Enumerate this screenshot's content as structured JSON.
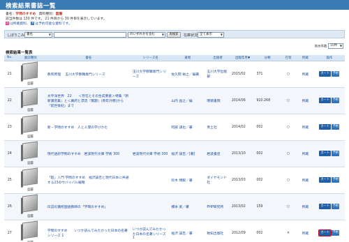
{
  "page_title": "検索結果書誌一覧",
  "criteria": {
    "label1": "書名：",
    "value1": "学問のすすめ",
    "label2": "資料種別：",
    "value2": "図書",
    "summary": "該当件数は 130 件です。 21 件目から 30 件目を表示しています。",
    "check1_icon": "カ",
    "check1_text": "は所蔵資料、",
    "check2_icon": "予",
    "check2_text": "は予約可能な資料です。"
  },
  "refine": {
    "label": "しぼりこみ",
    "field_select": "書名",
    "match_select": "のいずれかを含む",
    "search_button": "再検索",
    "status_label": "在庫状況",
    "status_select": "全て表示"
  },
  "display_count": {
    "label": "表示件数",
    "value": "10件"
  },
  "list_title": "検索結果一覧表",
  "columns": [
    "No.",
    "書誌種別",
    "書名",
    "シリーズ名",
    "著者",
    "出版者",
    "出版年月▼",
    "分類",
    "在架",
    "所蔵",
    "操作"
  ],
  "rows": [
    {
      "no": "21",
      "type": "図書",
      "title": "教育原理　 玉川大学教職専門シリーズ",
      "series": "玉川大学教職専門シリーズ",
      "author": "佐久間 裕之／編著",
      "publisher": "玉川大学出版部",
      "date": "2015/02",
      "class": "371",
      "shelf": "○",
      "holdings": "所蔵",
      "cart": "カート",
      "reserve": "予約"
    },
    {
      "no": "22",
      "type": "図書",
      "title": "太平洋世界　22　　＜存在とその生成要素＞特集『新新講習集』と＜幕府と漂流『無題』(青年外務)から『前世後紀』まで",
      "series": "",
      "author": "山内 昌之／編",
      "publisher": "明徳書院",
      "date": "2014/06",
      "class": "910.268",
      "shelf": "○",
      "holdings": "所蔵",
      "cart": "カート",
      "reserve": "予約"
    },
    {
      "no": "23",
      "type": "図書",
      "title": "新・学問のすすめ　人と人間の学びかた",
      "series": "",
      "author": "阿部 謹也／著",
      "publisher": "青土社",
      "date": "2014/02",
      "class": "002",
      "shelf": "○",
      "holdings": "所蔵",
      "cart": "カート",
      "reserve": "予約"
    },
    {
      "no": "24",
      "type": "図書",
      "title": "現代語訳学問のすすめ　岩波現代文庫 学術 300",
      "series": "岩波現代文庫 学術 300",
      "author": "福沢 諭吉／[著]",
      "publisher": "岩波書店",
      "date": "2013/10",
      "class": "002",
      "shelf": "○",
      "holdings": "所蔵",
      "cart": "カート",
      "reserve": "予約"
    },
    {
      "no": "25",
      "type": "図書",
      "title": "「超」入門 学問のすすめ　福沢諭吉と現代日本に共通する23のサバイバル戦略",
      "series": "",
      "author": "鈴木 博毅／著",
      "publisher": "ダイヤモンド社",
      "date": "2013/03",
      "class": "002",
      "shelf": "○",
      "holdings": "所蔵",
      "cart": "カート",
      "reserve": "予約"
    },
    {
      "no": "26",
      "type": "図書",
      "title": "伝説の灘校国語教師の「学問のすすめ」",
      "series": "",
      "author": "橋本 武／著",
      "publisher": "PHP研究所",
      "date": "2013/02",
      "class": "159",
      "shelf": "○",
      "holdings": "所蔵",
      "cart": "カート",
      "reserve": "予約"
    },
    {
      "no": "27",
      "type": "図書",
      "title": "学問のすすめ　　いつか読んでみたかった日本の名著シリーズ 1",
      "series": "いつか読んでみたかった日本の名著シリーズ 1",
      "author": "福沢 諭吉／著",
      "publisher": "致知出版社",
      "date": "2012/09",
      "class": "002",
      "shelf": "×",
      "holdings": "所蔵",
      "cart": "カート",
      "reserve": "予約"
    }
  ],
  "colors": {
    "header_bar": "#3a7ab5",
    "table_header": "#d9e6f3",
    "button_blue": "#1f5fa8",
    "highlight": "#d0021b"
  }
}
